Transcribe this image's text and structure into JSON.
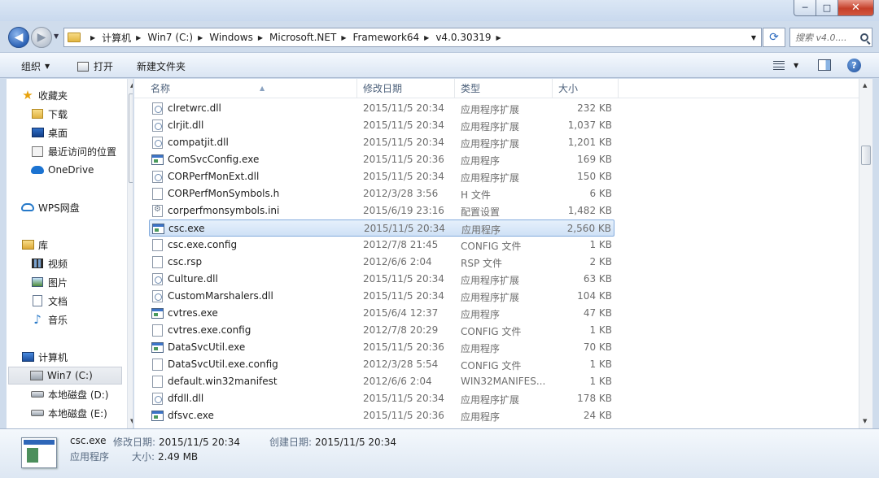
{
  "window": {
    "controls": {
      "minimize": "─",
      "maximize": "□",
      "close": "✕"
    }
  },
  "nav": {
    "back": "◀",
    "forward": "▶",
    "breadcrumbs": [
      "计算机",
      "Win7 (C:)",
      "Windows",
      "Microsoft.NET",
      "Framework64",
      "v4.0.30319"
    ],
    "search_placeholder": "搜索 v4.0...."
  },
  "toolbar": {
    "organize": "组织",
    "open": "打开",
    "new_folder": "新建文件夹",
    "help": "?"
  },
  "sidebar": {
    "items": [
      {
        "label": "收藏夹",
        "icon": "star-icon"
      },
      {
        "label": "下载",
        "icon": "downloads-folder-icon"
      },
      {
        "label": "桌面",
        "icon": "desktop-icon"
      },
      {
        "label": "最近访问的位置",
        "icon": "recent-places-icon"
      },
      {
        "label": "OneDrive",
        "icon": "onedrive-cloud-icon"
      },
      {
        "label": "WPS网盘",
        "icon": "wps-cloud-icon"
      },
      {
        "label": "库",
        "icon": "library-icon"
      },
      {
        "label": "视频",
        "icon": "videos-icon"
      },
      {
        "label": "图片",
        "icon": "pictures-icon"
      },
      {
        "label": "文档",
        "icon": "documents-icon"
      },
      {
        "label": "音乐",
        "icon": "music-icon"
      },
      {
        "label": "计算机",
        "icon": "computer-icon"
      },
      {
        "label": "Win7 (C:)",
        "icon": "system-drive-icon"
      },
      {
        "label": "本地磁盘 (D:)",
        "icon": "drive-icon"
      },
      {
        "label": "本地磁盘 (E:)",
        "icon": "drive-icon"
      }
    ]
  },
  "columns": {
    "name": "名称",
    "date": "修改日期",
    "type": "类型",
    "size": "大小"
  },
  "files": [
    {
      "name": "clretwrc.dll",
      "date": "2015/11/5 20:34",
      "type": "应用程序扩展",
      "size": "232 KB",
      "kind": "dll"
    },
    {
      "name": "clrjit.dll",
      "date": "2015/11/5 20:34",
      "type": "应用程序扩展",
      "size": "1,037 KB",
      "kind": "dll"
    },
    {
      "name": "compatjit.dll",
      "date": "2015/11/5 20:34",
      "type": "应用程序扩展",
      "size": "1,201 KB",
      "kind": "dll"
    },
    {
      "name": "ComSvcConfig.exe",
      "date": "2015/11/5 20:36",
      "type": "应用程序",
      "size": "169 KB",
      "kind": "exe"
    },
    {
      "name": "CORPerfMonExt.dll",
      "date": "2015/11/5 20:34",
      "type": "应用程序扩展",
      "size": "150 KB",
      "kind": "dll"
    },
    {
      "name": "CORPerfMonSymbols.h",
      "date": "2012/3/28 3:56",
      "type": "H 文件",
      "size": "6 KB",
      "kind": "file"
    },
    {
      "name": "corperfmonsymbols.ini",
      "date": "2015/6/19 23:16",
      "type": "配置设置",
      "size": "1,482 KB",
      "kind": "ini"
    },
    {
      "name": "csc.exe",
      "date": "2015/11/5 20:34",
      "type": "应用程序",
      "size": "2,560 KB",
      "kind": "exe"
    },
    {
      "name": "csc.exe.config",
      "date": "2012/7/8 21:45",
      "type": "CONFIG 文件",
      "size": "1 KB",
      "kind": "file"
    },
    {
      "name": "csc.rsp",
      "date": "2012/6/6 2:04",
      "type": "RSP 文件",
      "size": "2 KB",
      "kind": "file"
    },
    {
      "name": "Culture.dll",
      "date": "2015/11/5 20:34",
      "type": "应用程序扩展",
      "size": "63 KB",
      "kind": "dll"
    },
    {
      "name": "CustomMarshalers.dll",
      "date": "2015/11/5 20:34",
      "type": "应用程序扩展",
      "size": "104 KB",
      "kind": "dll"
    },
    {
      "name": "cvtres.exe",
      "date": "2015/6/4 12:37",
      "type": "应用程序",
      "size": "47 KB",
      "kind": "exe"
    },
    {
      "name": "cvtres.exe.config",
      "date": "2012/7/8 20:29",
      "type": "CONFIG 文件",
      "size": "1 KB",
      "kind": "file"
    },
    {
      "name": "DataSvcUtil.exe",
      "date": "2015/11/5 20:36",
      "type": "应用程序",
      "size": "70 KB",
      "kind": "exe"
    },
    {
      "name": "DataSvcUtil.exe.config",
      "date": "2012/3/28 5:54",
      "type": "CONFIG 文件",
      "size": "1 KB",
      "kind": "file"
    },
    {
      "name": "default.win32manifest",
      "date": "2012/6/6 2:04",
      "type": "WIN32MANIFES...",
      "size": "1 KB",
      "kind": "file"
    },
    {
      "name": "dfdll.dll",
      "date": "2015/11/5 20:34",
      "type": "应用程序扩展",
      "size": "178 KB",
      "kind": "dll"
    },
    {
      "name": "dfsvc.exe",
      "date": "2015/11/5 20:36",
      "type": "应用程序",
      "size": "24 KB",
      "kind": "exe"
    }
  ],
  "details": {
    "filename": "csc.exe",
    "modified_label": "修改日期:",
    "modified": "2015/11/5 20:34",
    "created_label": "创建日期:",
    "created": "2015/11/5 20:34",
    "type": "应用程序",
    "size_label": "大小:",
    "size": "2.49 MB"
  }
}
